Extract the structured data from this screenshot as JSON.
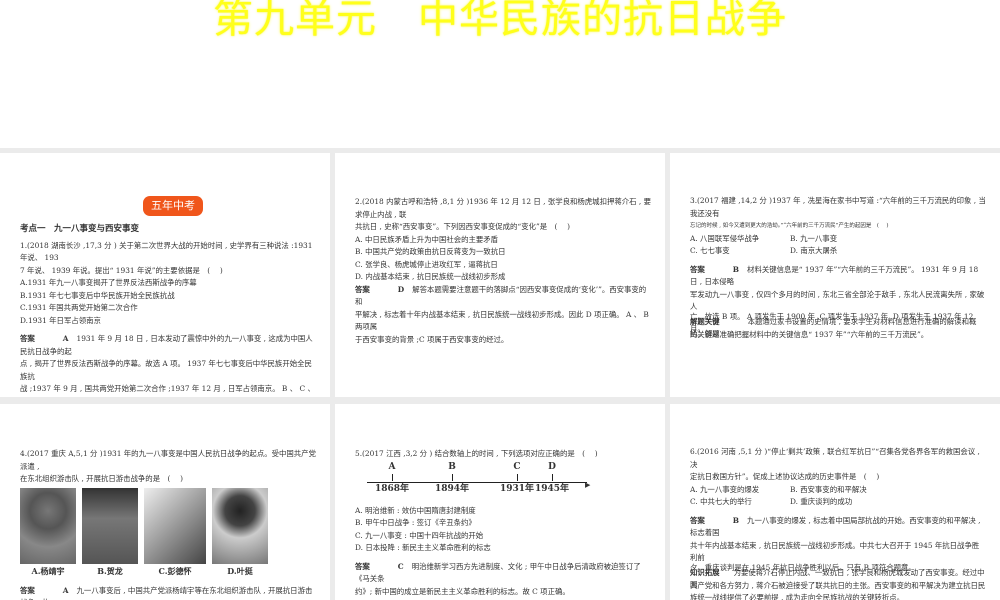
{
  "title": "第九单元　中华民族的抗日战争",
  "badge": "五年中考",
  "section": "考点一　九一八事变与西安事变",
  "answer_label": "答案",
  "key_label": "解题关键",
  "knowledge_label": "知识拓展",
  "q1": {
    "stem": [
      "1.(2018 湖南长沙 ,17,3 分 ) 关于第二次世界大战的开始时间 , 史学界有三种说法 :1931 年说、 193",
      "7 年说、 1939 年说。提出“ 1931 年说”的主要依据是　(　 )"
    ],
    "options": [
      "A.1931 年九一八事变揭开了世界反法西斯战争的序幕",
      "B.1931 年七七事变后中华民族开始全民族抗战",
      "C.1931 年国共两党开始第二次合作",
      "D.1931 年日军占领南京"
    ],
    "answer": "A",
    "explain": [
      "1931 年 9 月 18 日 , 日本发动了震惊中外的九一八事变 , 这成为中国人民抗日战争的起",
      "点 , 揭开了世界反法西斯战争的序幕。故选 A 项。 1937 年七七事变后中华民族开始全民族抗",
      "战 ;1937 年 9 月 , 国共两党开始第二次合作 ;1937 年 12 月 , 日军占领南京。 B 、 C 、 D 三项均错",
      "误。"
    ]
  },
  "q2": {
    "stem": [
      "2.(2018 内蒙古呼和浩特 ,8,1 分 )1936 年 12 月 12 日 , 张学良和杨虎城扣押蒋介石 , 要求停止内战 , 联",
      "共抗日 , 史称“西安事变”。下列因西安事变促成的“变化”是　(　 )"
    ],
    "options": [
      "A. 中日民族矛盾上升为中国社会的主要矛盾",
      "B. 中国共产党的政策由抗日反蒋变为一致抗日",
      "C. 张学良、杨虎城停止进攻红军 , 逼蒋抗日",
      "D. 内战基本结束 , 抗日民族统一战线初步形成"
    ],
    "answer": "D",
    "explain": [
      "解答本题需要注意题干的落脚点“因西安事变促成的‘变化’”。西安事变的和",
      "平解决 , 标志着十年内战基本结束 , 抗日民族统一战线初步形成。因此 D 项正确。 A 、 B 两项属",
      "于西安事变的背景 ;C 项属于西安事变的经过。"
    ]
  },
  "q3": {
    "stem": [
      "3.(2017 福建 ,14,2 分 )1937 年 , 冼星海在家书中写道 :“六年前的三千万流民的印象 , 当我还没有",
      "忘记的时候 , 如今又遭到更大的浩劫。”“六年前的三千万流民”产生的起因是　(　 )"
    ],
    "options": [
      "A. 八国联军侵华战争",
      "B. 九一八事变",
      "C. 七七事变",
      "D. 南京大屠杀"
    ],
    "answer": "B",
    "explain": [
      "材料关键信息是“ 1937 年”“六年前的三千万流民”。 1931 年 9 月 18 日 , 日本侵略",
      "军发动九一八事变 , 仅四个多月的时间 , 东北三省全部沦于敌手 , 东北人民流离失所 , 家破人",
      "亡。故选 B 项。 A 项发生于 1900 年 ,C 项发生于 1937 年 ,D 项发生于 1937 年 12 月。"
    ],
    "key": [
      "本题通过家书设置的史情境 , 要求学生对材料信息进行准确的解读和概括。解题",
      "的关键是准确把握材料中的关键信息“ 1937 年”“六年前的三千万流民”。"
    ]
  },
  "q4": {
    "stem": [
      "4.(2017 重庆 A,5,1 分 )1931 年的九一八事变是中国人民抗日战争的起点。受中国共产党派遣 ,",
      "在东北组织游击队 , 开展抗日游击战争的是　(　 )"
    ],
    "photos": [
      "A.杨靖宇",
      "B.贺龙",
      "C.彭德怀",
      "D.叶挺"
    ],
    "answer": "A",
    "explain": [
      "九一八事变后 , 中国共产党派杨靖宇等在东北组织游击队 , 开展抗日游击战争。故"
    ]
  },
  "q5": {
    "stem": [
      "5.(2017 江西 ,3,2 分 ) 结合数轴上的时间 , 下列选项对应正确的是　(　 )"
    ],
    "timeline": [
      {
        "letter": "A",
        "year": "1868年"
      },
      {
        "letter": "B",
        "year": "1894年"
      },
      {
        "letter": "C",
        "year": "1931年"
      },
      {
        "letter": "D",
        "year": "1945年"
      }
    ],
    "options": [
      "A. 明治维新 : 效仿中国隋唐封建制度",
      "B. 甲午中日战争 : 签订《辛丑条约》",
      "C. 九一八事变 : 中国十四年抗战的开始",
      "D. 日本投降 : 新民主主义革命胜利的标志"
    ],
    "answer": "C",
    "explain": [
      "明治维新学习西方先进制度、文化 ; 甲午中日战争后清政府被迫签订了《马关条",
      "约》; 新中国的成立是新民主主义革命胜利的标志。故 C 项正确。"
    ]
  },
  "q6": {
    "stem": [
      "6.(2016 河南 ,5,1 分 )“停止‘剿共’政策 , 联合红军抗日”“召集各党各界各军的救国会议 , 决",
      "定抗日救国方针”。促成上述协议达成的历史事件是　(　 )"
    ],
    "options": [
      "A. 九一八事变的爆发",
      "B. 西安事变的和平解决",
      "C. 中共七大的举行",
      "D. 重庆谈判的成功"
    ],
    "answer": "B",
    "explain": [
      "九一八事变的爆发 , 标志着中国局部抗战的开始。西安事变的和平解决 , 标志着国",
      "共十年内战基本结束 , 抗日民族统一战线初步形成。中共七大召开于 1945 年抗日战争胜利前",
      "夕。重庆谈判是在 1945 年抗日战争胜利以后。只有 B 项符合题意。"
    ],
    "knowledge": [
      "为要使蒋介石停止内战、一致抗日 , 张学良和杨虎城发动了西安事变。经过中国",
      "共产党和各方努力 , 蒋介石被迫接受了联共抗日的主张。西安事变的和平解决为建立抗日民",
      "族统一战线提供了必要前提 , 成为走向全民族抗战的关键转折点。"
    ]
  }
}
